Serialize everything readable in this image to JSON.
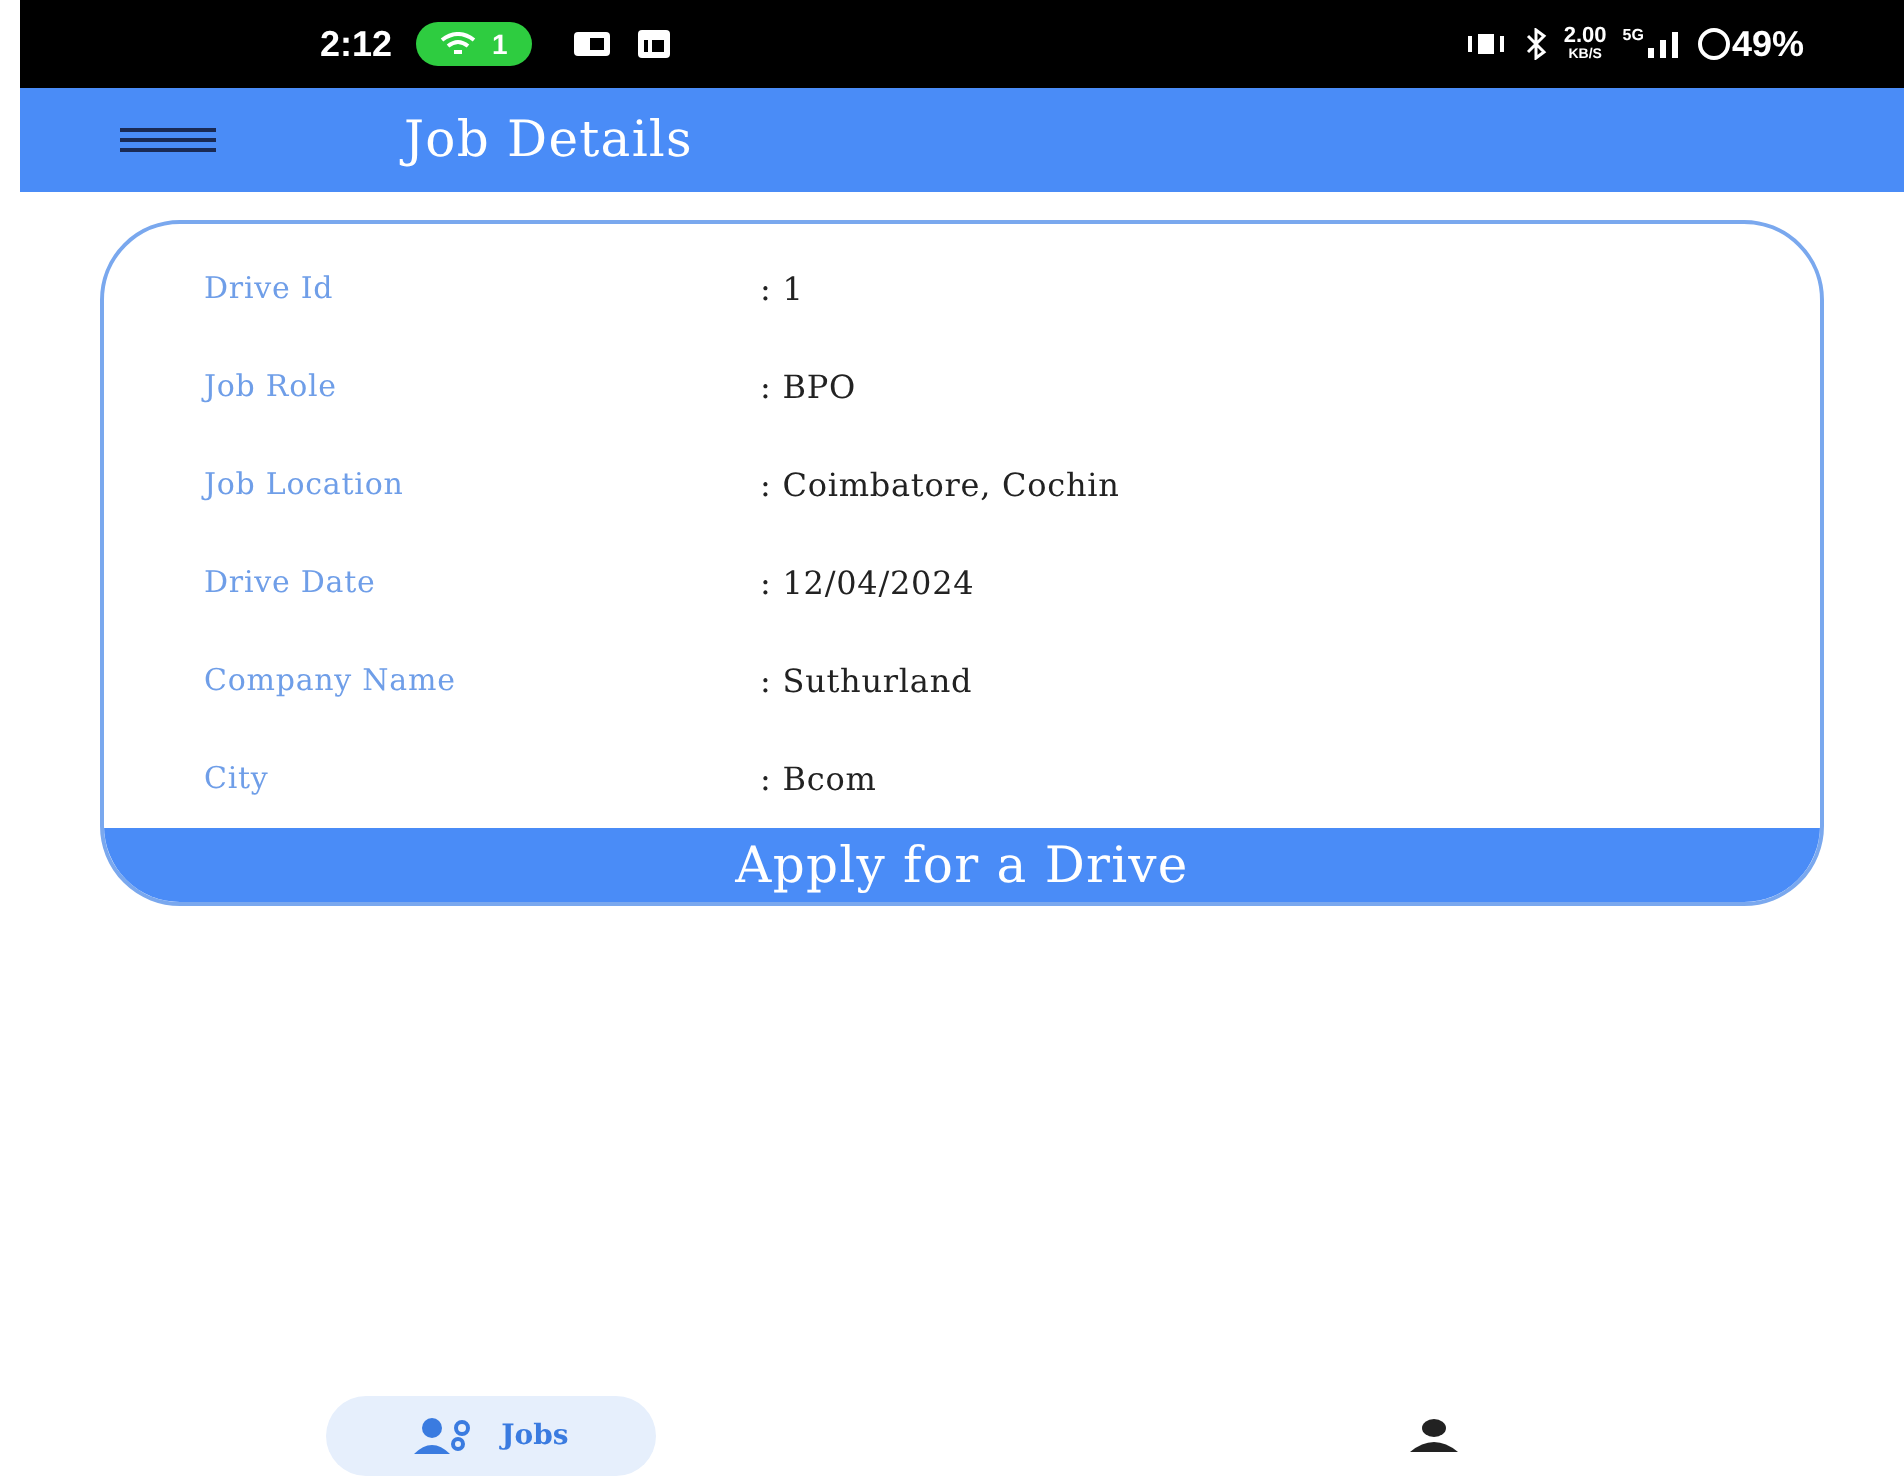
{
  "status_bar": {
    "time": "2:12",
    "hotspot_badge": "1",
    "speed": "2.00",
    "speed_unit": "KB/S",
    "network": "5G",
    "battery": "49%"
  },
  "app_bar": {
    "title": "Job Details"
  },
  "details": [
    {
      "label": "Drive Id",
      "value": ": 1"
    },
    {
      "label": "Job Role",
      "value": ": BPO"
    },
    {
      "label": "Job Location",
      "value": ": Coimbatore, Cochin"
    },
    {
      "label": "Drive Date",
      "value": ": 12/04/2024"
    },
    {
      "label": "Company Name",
      "value": ": Suthurland"
    },
    {
      "label": "City",
      "value": ": Bcom"
    }
  ],
  "apply_button": "Apply for a Drive",
  "bottom_nav": [
    {
      "kind": "jobs",
      "label": "Jobs",
      "selected": true
    },
    {
      "kind": "profile",
      "selected": false
    }
  ]
}
